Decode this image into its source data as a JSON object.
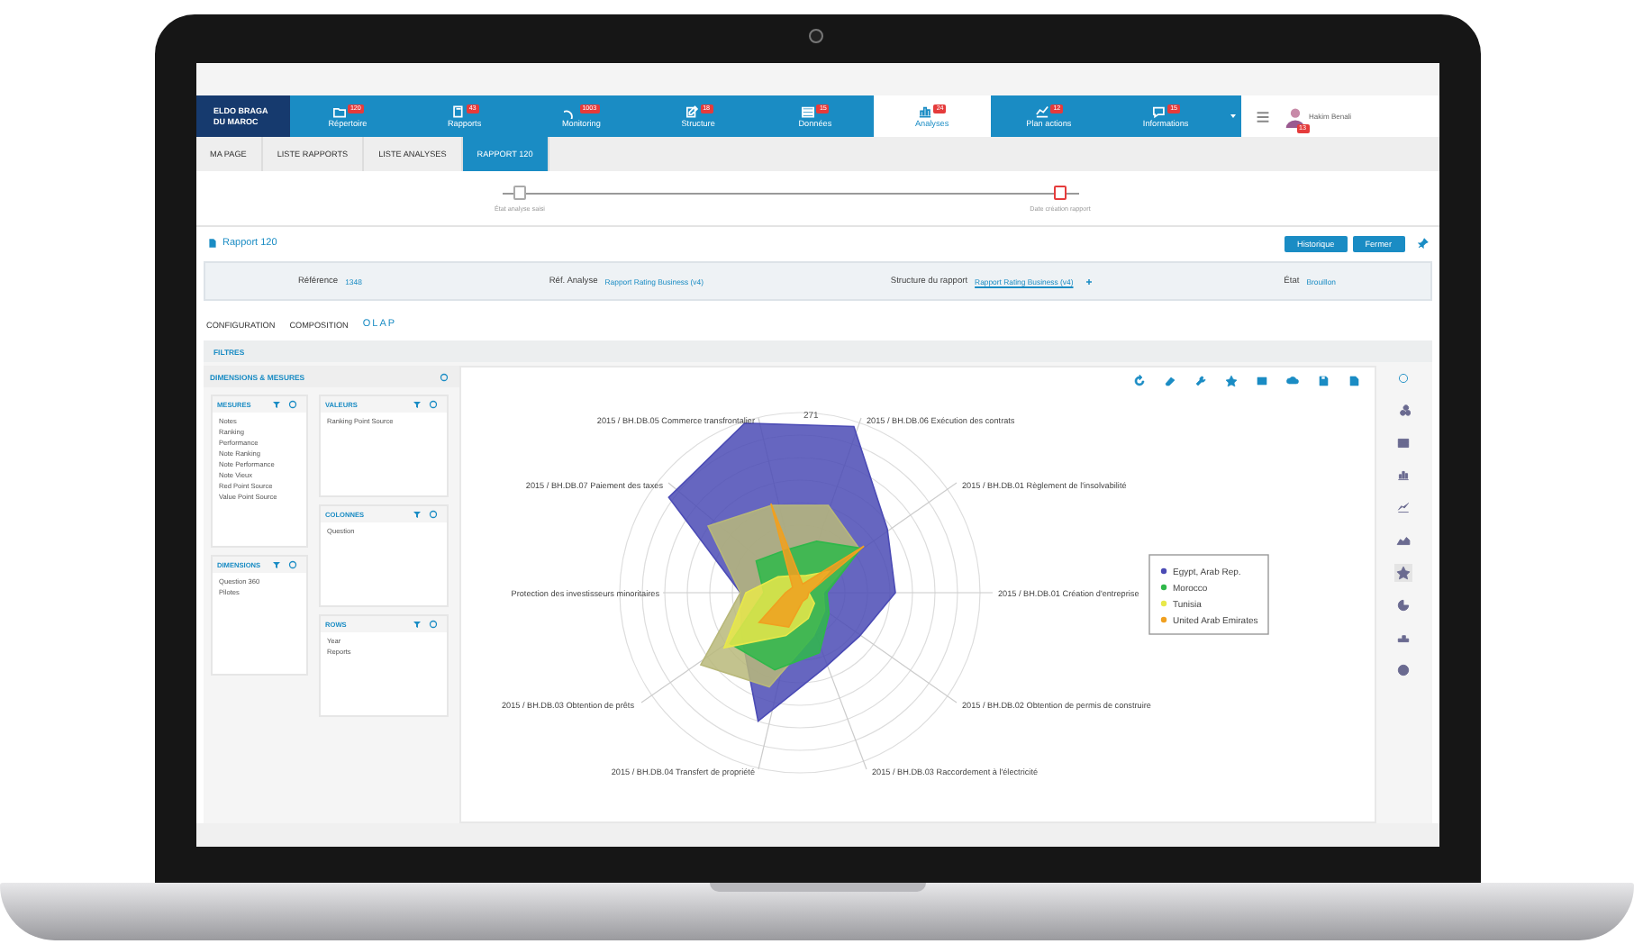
{
  "logo": {
    "lines": [
      "ELDO BRAGA",
      "DU MAROC"
    ]
  },
  "nav": [
    {
      "label": "Répertoire",
      "badge": "120",
      "selected": false
    },
    {
      "label": "Rapports",
      "badge": "43",
      "selected": false
    },
    {
      "label": "Monitoring",
      "badge": "1003",
      "selected": false
    },
    {
      "label": "Structure",
      "badge": "18",
      "selected": false
    },
    {
      "label": "Données",
      "badge": "15",
      "selected": false
    },
    {
      "label": "Analyses",
      "badge": "24",
      "selected": true
    },
    {
      "label": "Plan actions",
      "badge": "12",
      "selected": false
    },
    {
      "label": "Informations",
      "badge": "15",
      "selected": false
    }
  ],
  "user": {
    "name": "Hakim Benali",
    "badge": "13"
  },
  "tabs": [
    {
      "label": "MA PAGE",
      "selected": false
    },
    {
      "label": "LISTE RAPPORTS",
      "selected": false
    },
    {
      "label": "LISTE ANALYSES",
      "selected": false
    },
    {
      "label": "RAPPORT 120",
      "selected": true
    }
  ],
  "stepper": [
    {
      "label": "État analyse saisi",
      "current": false
    },
    {
      "label": "Date création rapport",
      "current": true
    }
  ],
  "report": {
    "title": "Rapport 120",
    "buttons": [
      "Historique",
      "Fermer"
    ]
  },
  "info": [
    {
      "label": "Référence",
      "value": "1348",
      "link": false
    },
    {
      "label": "Réf. Analyse",
      "value": "Rapport Rating Business (v4)",
      "link": false
    },
    {
      "label": "Structure du rapport",
      "value": "Rapport Rating Business (v4)",
      "link": true
    },
    {
      "label": "État",
      "value": "Brouillon",
      "link": false
    }
  ],
  "subtabs": [
    {
      "label": "CONFIGURATION",
      "selected": false
    },
    {
      "label": "COMPOSITION",
      "selected": false
    },
    {
      "label": "OLAP",
      "selected": true
    }
  ],
  "filters": {
    "title": "FILTRES"
  },
  "fields_panel": {
    "title": "DIMENSIONS & MESURES",
    "left_lists": [
      {
        "title": "MESURES",
        "items": [
          "Notes",
          "Ranking",
          "Performance",
          "Note Ranking",
          "Note Performance",
          "Note Vieux",
          "Red Point Source",
          "Value Point Source"
        ]
      },
      {
        "title": "DIMENSIONS",
        "items": [
          "Question 360",
          "Pilotes"
        ]
      }
    ],
    "right_lists": [
      {
        "title": "VALEURS",
        "items": [
          "Ranking Point Source"
        ]
      },
      {
        "title": "COLONNES",
        "items": [
          "Question"
        ]
      },
      {
        "title": "ROWS",
        "items": [
          "Year",
          "Reports"
        ]
      }
    ]
  },
  "chart": {
    "tick": "271",
    "axis_labels": [
      "2015 / BH.DB.05 Commerce transfrontalier",
      "2015 / BH.DB.06 Exécution des contrats",
      "2015 / BH.DB.07 Paiement des taxes",
      "2015 / BH.DB.01 Règlement de l'insolvabilité",
      "Protection des investisseurs minoritaires",
      "2015 / BH.DB.01 Création d'entreprise",
      "2015 / BH.DB.03 Obtention de prêts",
      "2015 / BH.DB.02 Obtention de permis de construire",
      "2015 / BH.DB.04 Transfert de propriété",
      "2015 / BH.DB.03 Raccordement à l'électricité"
    ],
    "series": [
      {
        "name": "Egypt, Arab Rep.",
        "color": "#4b4bb5"
      },
      {
        "name": "Morocco",
        "color": "#2fb84a"
      },
      {
        "name": "Tunisia",
        "color": "#e8e84a"
      },
      {
        "name": "United Arab Emirates",
        "color": "#f0a020"
      }
    ]
  }
}
